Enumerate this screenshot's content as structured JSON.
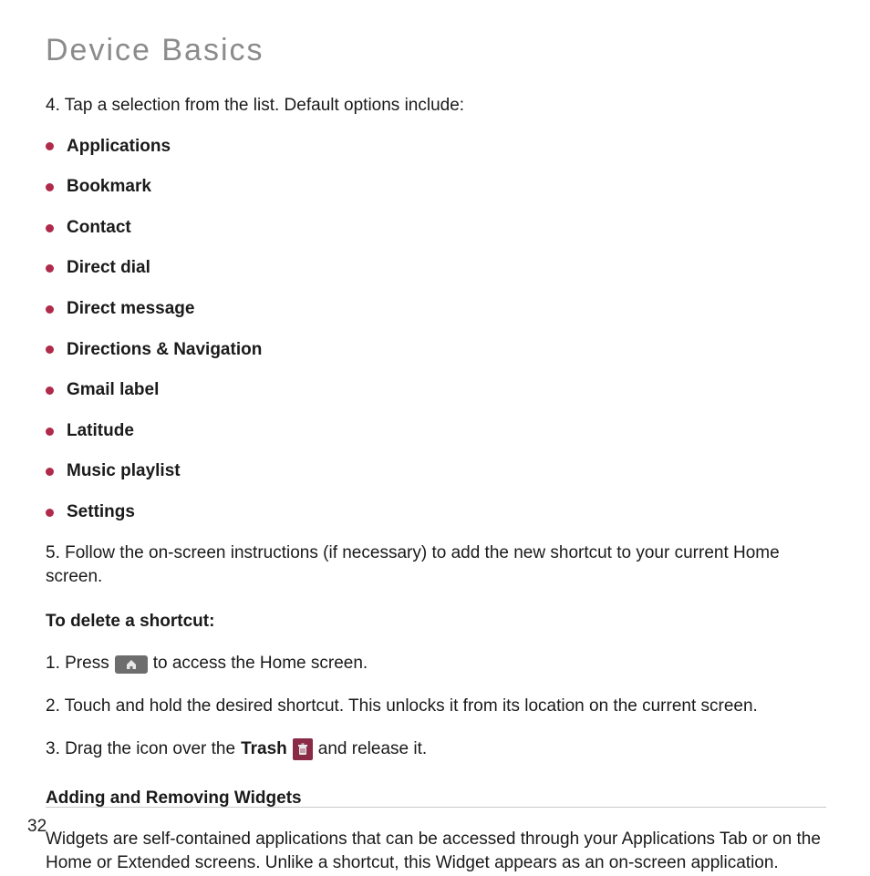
{
  "title": "Device Basics",
  "step4": "4. Tap a selection from the list. Default options include:",
  "bullets": [
    "Applications",
    "Bookmark",
    "Contact",
    "Direct dial",
    "Direct message",
    "Directions & Navigation",
    "Gmail label",
    "Latitude",
    "Music playlist",
    "Settings"
  ],
  "step5": "5. Follow the on-screen instructions (if necessary) to add the new shortcut to your current Home screen.",
  "deleteHead": "To delete a shortcut:",
  "del1_a": "1. Press",
  "del1_b": "to access the Home screen.",
  "del2": "2. Touch and hold the desired shortcut. This unlocks it from its location on the current screen.",
  "del3_a": "3. Drag the icon over the",
  "del3_trash": "Trash",
  "del3_b": "and release it.",
  "widgetsHead": "Adding and Removing Widgets",
  "widgetsPara": "Widgets are self-contained applications that can be accessed through your Applications Tab or on the Home or Extended screens. Unlike a shortcut, this Widget appears as an on-screen application.",
  "pageNumber": "32"
}
